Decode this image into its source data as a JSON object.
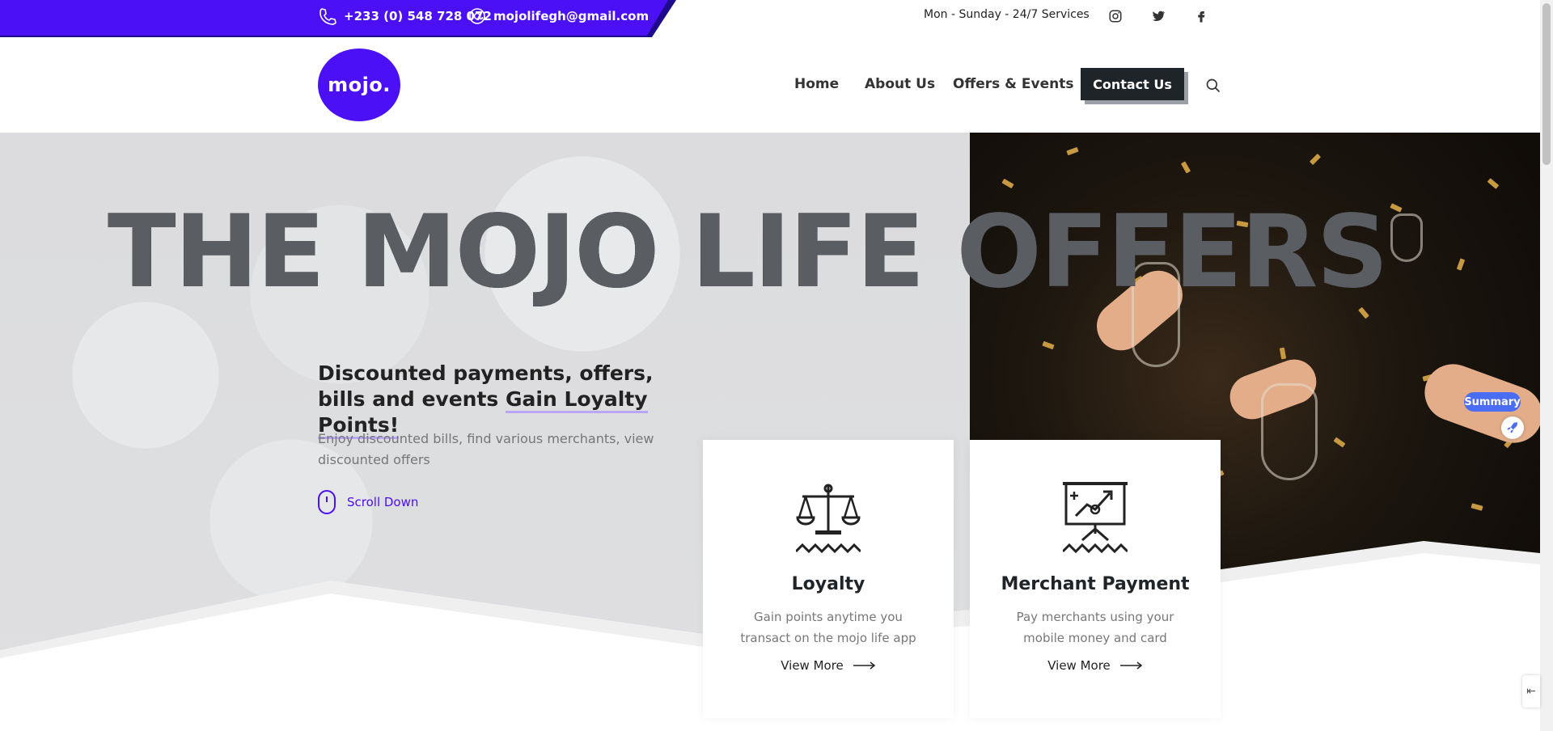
{
  "topbar": {
    "phone": "+233 (0) 548 728 072",
    "email": "mojolifegh@gmail.com",
    "services": "Mon - Sunday - 24/7 Services",
    "social": [
      "instagram-icon",
      "twitter-icon",
      "facebook-icon"
    ]
  },
  "nav": {
    "logo": "mojo.",
    "links": [
      "Home",
      "About Us",
      "Offers & Events"
    ],
    "cta": "Contact Us"
  },
  "hero": {
    "title": "THE MOJO LIFE OFFERS",
    "heading_part1": "Discounted payments, offers, bills and events ",
    "heading_highlight": "Gain Loyalty Points!",
    "subtext": "Enjoy discounted bills, find various merchants, view discounted offers",
    "scroll_label": "Scroll Down"
  },
  "cards": [
    {
      "title": "Loyalty",
      "desc": "Gain points anytime you transact on the mojo life app",
      "more": "View More",
      "icon": "scale-icon"
    },
    {
      "title": "Merchant Payment",
      "desc": "Pay merchants using your mobile money and card",
      "more": "View More",
      "icon": "presentation-board-icon"
    }
  ],
  "widget": {
    "summary": "Summary"
  },
  "colors": {
    "brand": "#4b10f5",
    "dark": "#1f2429",
    "accent_green": "#4de0a0"
  }
}
